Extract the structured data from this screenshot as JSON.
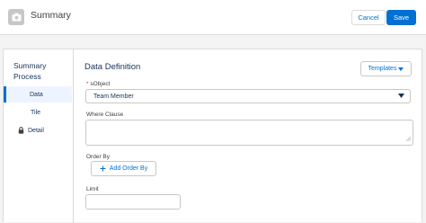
{
  "header": {
    "title": "Summary",
    "icon": "summary-icon",
    "cancel_label": "Cancel",
    "save_label": "Save"
  },
  "sidebar": {
    "title": "Summary Process",
    "items": [
      {
        "label": "Data",
        "active": true
      },
      {
        "label": "Tile",
        "active": false
      },
      {
        "label": "Detail",
        "active": false,
        "icon": "lock-icon"
      }
    ]
  },
  "main": {
    "section_title": "Data Definition",
    "templates_label": "Templates",
    "sobject": {
      "required_mark": "*",
      "label": "sObject",
      "value": "Team Member"
    },
    "where_clause": {
      "label": "Where Clause",
      "value": ""
    },
    "order_by": {
      "label": "Order By",
      "add_label": "Add Order By"
    },
    "limit": {
      "label": "Limit",
      "value": ""
    }
  },
  "colors": {
    "accent": "#0070d2",
    "text": "#16325c",
    "border": "#dddbda"
  }
}
